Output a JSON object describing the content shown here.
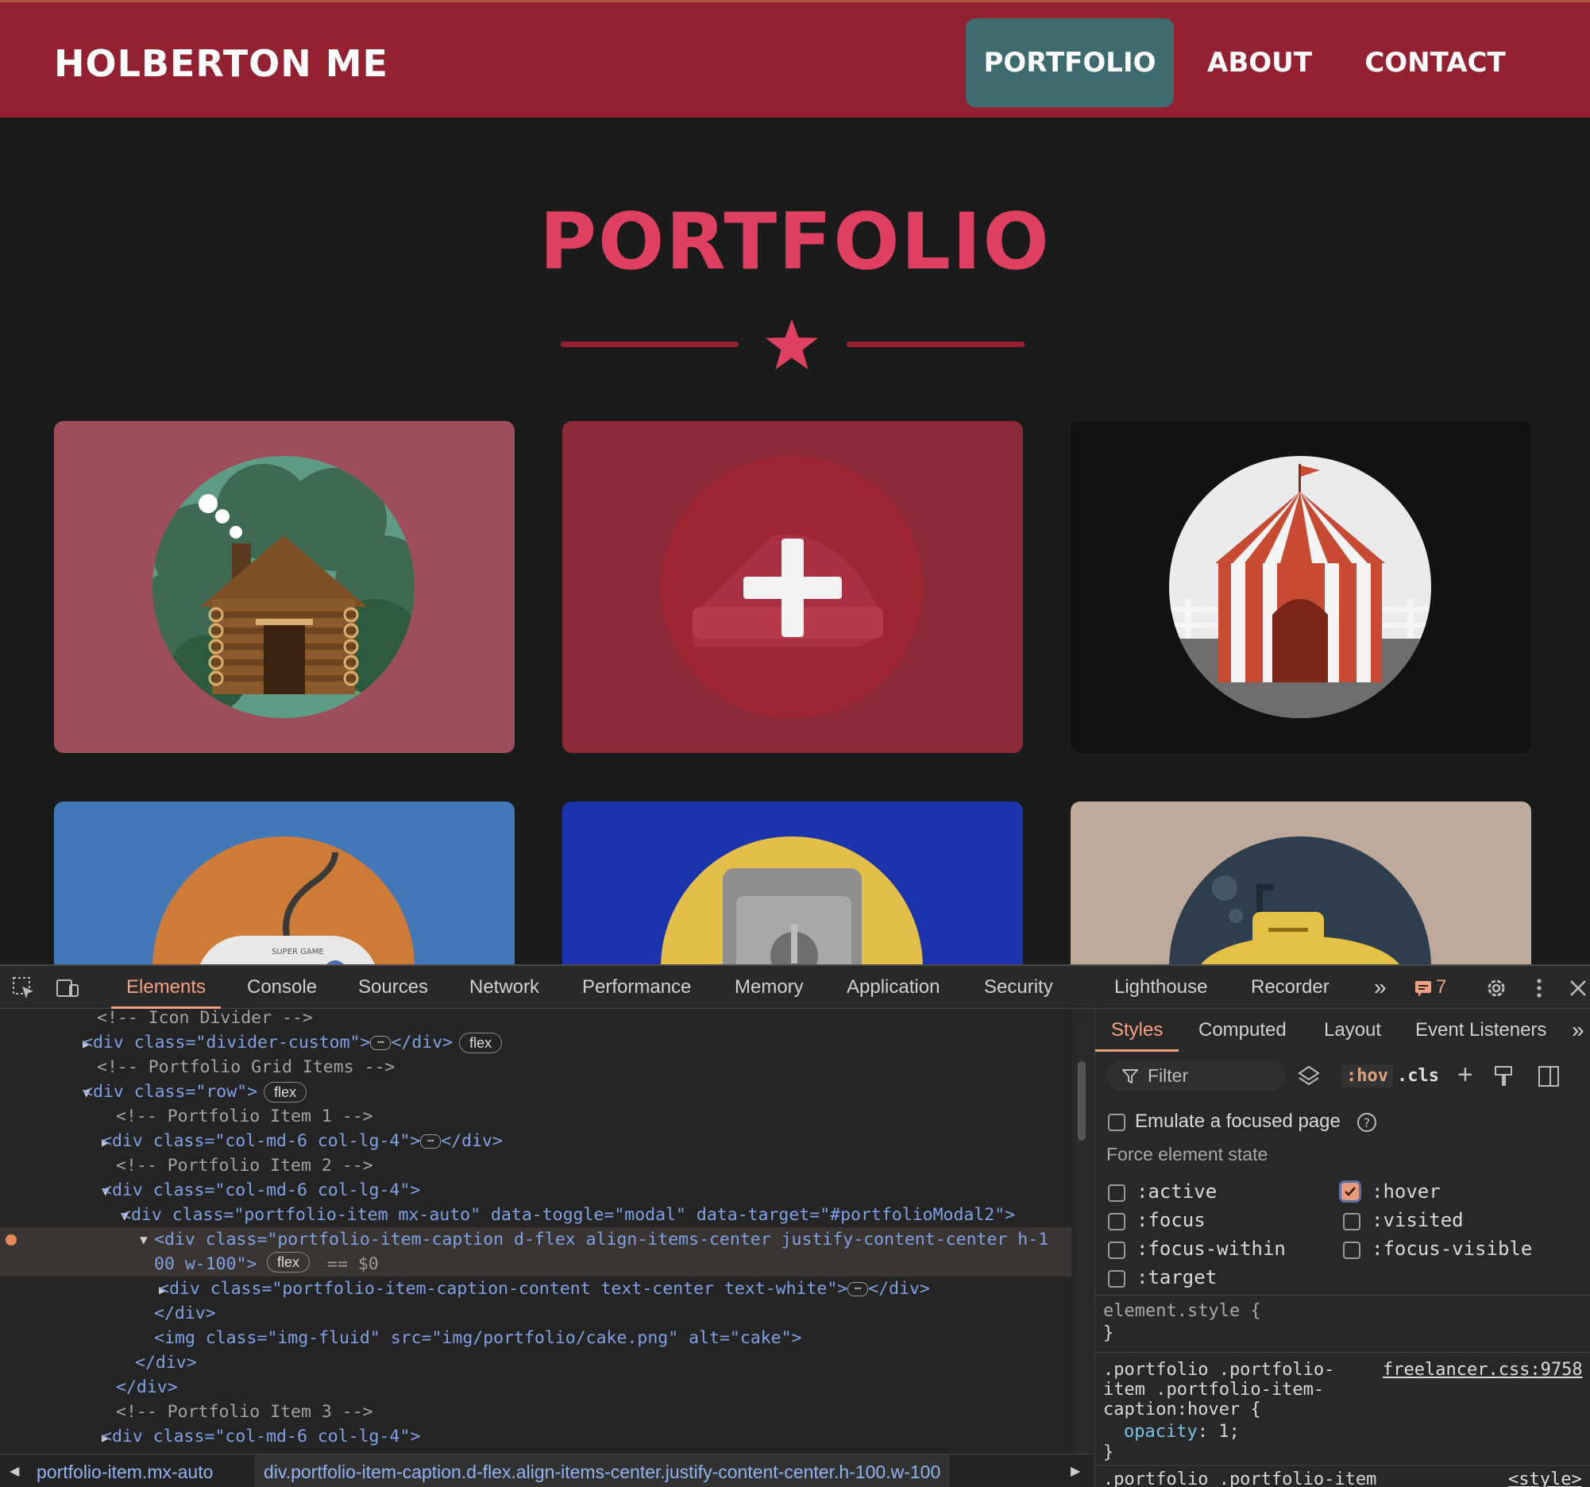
{
  "navbar": {
    "brand": "HOLBERTON ME",
    "links": [
      "PORTFOLIO",
      "ABOUT",
      "CONTACT"
    ],
    "active": "PORTFOLIO"
  },
  "section": {
    "title": "PORTFOLIO"
  },
  "portfolio_tiles": [
    {
      "name": "cabin",
      "bg": "#9e4d5a"
    },
    {
      "name": "cake",
      "bg": "#8b2a36",
      "hover_overlay": true
    },
    {
      "name": "circus",
      "bg": "#121212"
    },
    {
      "name": "game",
      "bg": "#4378b8",
      "badge": "SUPER GAME"
    },
    {
      "name": "safe",
      "bg": "#1b34ad"
    },
    {
      "name": "submarine",
      "bg": "#bea99a"
    }
  ],
  "devtools": {
    "tabs": [
      "Elements",
      "Console",
      "Sources",
      "Network",
      "Performance",
      "Memory",
      "Application",
      "Security",
      "Lighthouse",
      "Recorder"
    ],
    "active_tab": "Elements",
    "issues_count": "7",
    "dom_lines": [
      "<!-- Icon Divider -->",
      "<div class=\"divider-custom\">",
      "<!-- Portfolio Grid Items -->",
      "<div class=\"row\">",
      "<!-- Portfolio Item 1 -->",
      "<div class=\"col-md-6 col-lg-4\">",
      "<!-- Portfolio Item 2 -->",
      "<div class=\"col-md-6 col-lg-4\">",
      "<div class=\"portfolio-item mx-auto\" data-toggle=\"modal\" data-target=\"#portfolioModal2\">",
      "<div class=\"portfolio-item-caption d-flex align-items-center justify-content-center h-1",
      "00 w-100\">",
      "<div class=\"portfolio-item-caption-content text-center text-white\">",
      "</div>",
      "<img class=\"img-fluid\" src=\"img/portfolio/cake.png\" alt=\"cake\">",
      "</div>",
      "</div>",
      "<!-- Portfolio Item 3 -->",
      "<div class=\"col-md-6 col-lg-4\">"
    ],
    "pill_flex": "flex",
    "selected_marker": "== $0",
    "breadcrumbs": [
      "portfolio-item.mx-auto",
      "div.portfolio-item-caption.d-flex.align-items-center.justify-content-center.h-100.w-100"
    ],
    "styles": {
      "tabs": [
        "Styles",
        "Computed",
        "Layout",
        "Event Listeners"
      ],
      "active_tab": "Styles",
      "filter_placeholder": "Filter",
      "hov_label": ":hov",
      "cls_label": ".cls",
      "emulate_label": "Emulate a focused page",
      "force_state_title": "Force element state",
      "states": [
        {
          "label": ":active",
          "checked": false
        },
        {
          "label": ":hover",
          "checked": true
        },
        {
          "label": ":focus",
          "checked": false
        },
        {
          "label": ":visited",
          "checked": false
        },
        {
          "label": ":focus-within",
          "checked": false
        },
        {
          "label": ":focus-visible",
          "checked": false
        },
        {
          "label": ":target",
          "checked": false
        }
      ],
      "element_style": "element.style {",
      "close_brace": "}",
      "rule_selector": ".portfolio .portfolio-item .portfolio-item-caption:hover {",
      "rule_selector_lines": [
        ".portfolio .portfolio-",
        "item .portfolio-item-",
        "caption:hover {"
      ],
      "rule_source": "freelancer.css:9758",
      "rule_prop": "opacity",
      "rule_value": "1",
      "next_rule": ".portfolio .portfolio-item",
      "next_source": "<style>"
    }
  },
  "colors": {
    "navbar": "#93212f",
    "nav_active": "#3d6b70",
    "accent": "#e0405f",
    "page_bg": "#1a1b1b"
  }
}
